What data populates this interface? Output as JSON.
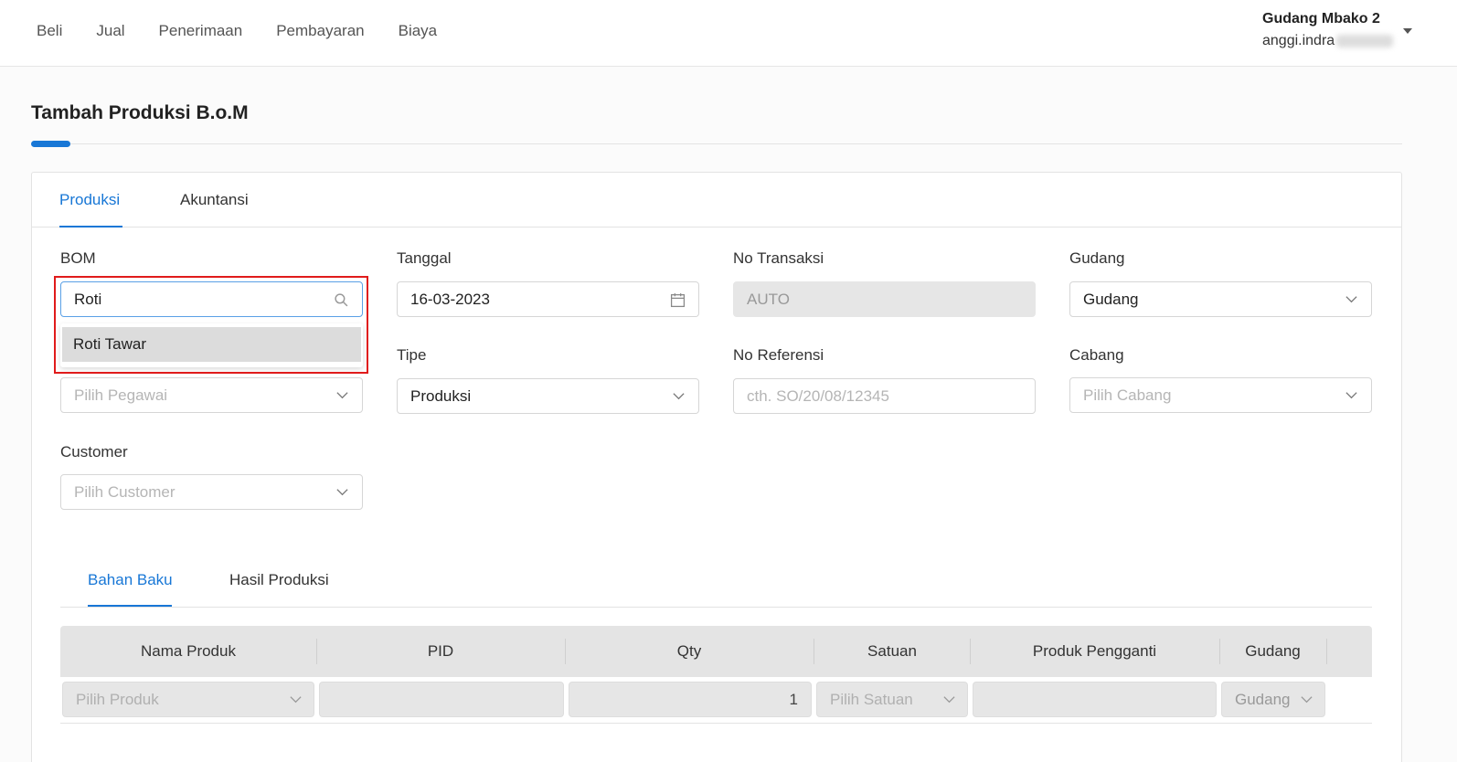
{
  "nav": {
    "items": [
      "Beli",
      "Jual",
      "Penerimaan",
      "Pembayaran",
      "Biaya"
    ]
  },
  "user": {
    "org": "Gudang Mbako 2",
    "email_prefix": "anggi.indra"
  },
  "page": {
    "title": "Tambah Produksi B.o.M"
  },
  "tabs": {
    "produksi": "Produksi",
    "akuntansi": "Akuntansi"
  },
  "form": {
    "bom": {
      "label": "BOM",
      "value": "Roti",
      "dropdown_option": "Roti Tawar"
    },
    "tanggal": {
      "label": "Tanggal",
      "value": "16-03-2023"
    },
    "no_transaksi": {
      "label": "No Transaksi",
      "value": "AUTO"
    },
    "gudang": {
      "label": "Gudang",
      "value": "Gudang"
    },
    "pegawai": {
      "placeholder": "Pilih Pegawai"
    },
    "tipe": {
      "label": "Tipe",
      "value": "Produksi"
    },
    "no_referensi": {
      "label": "No Referensi",
      "placeholder": "cth. SO/20/08/12345"
    },
    "cabang": {
      "label": "Cabang",
      "placeholder": "Pilih Cabang"
    },
    "customer": {
      "label": "Customer",
      "placeholder": "Pilih Customer"
    }
  },
  "sub_tabs": {
    "bahan_baku": "Bahan Baku",
    "hasil_produksi": "Hasil Produksi"
  },
  "table": {
    "headers": [
      "Nama Produk",
      "PID",
      "Qty",
      "Satuan",
      "Produk Pengganti",
      "Gudang"
    ],
    "row": {
      "produk_placeholder": "Pilih Produk",
      "qty": "1",
      "satuan_placeholder": "Pilih Satuan",
      "gudang": "Gudang"
    }
  }
}
